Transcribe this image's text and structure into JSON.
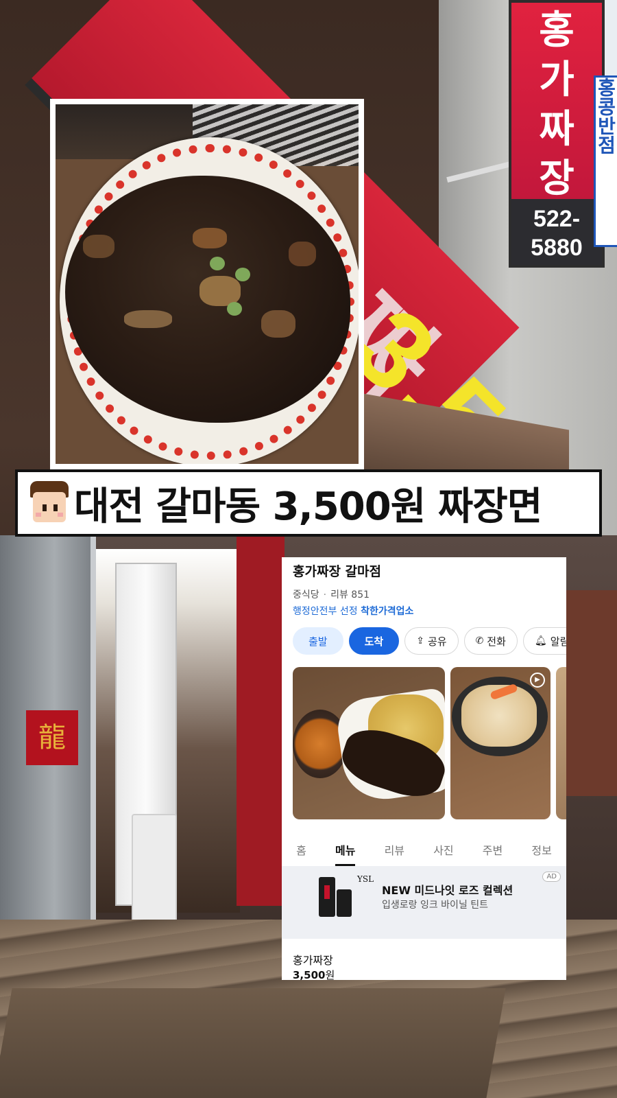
{
  "signage": {
    "main_deco": "가 짜 장",
    "main_price": "3,500",
    "vertical_text": "홍\n가\n짜\n장",
    "phone": "522-5880",
    "blue_sign": "홍콩반점"
  },
  "banner": {
    "title": "대전 갈마동 3,500원 짜장면"
  },
  "card": {
    "name": "홍가짜장 갈마점",
    "category": "중식당",
    "reviews": "리뷰 851",
    "gov_prefix": "행정안전부 선정",
    "gov_highlight": "착한가격업소",
    "buttons": {
      "depart": "출발",
      "arrive": "도착",
      "share": "공유",
      "call": "전화",
      "alert": "알림받기"
    },
    "tabs": [
      "홈",
      "메뉴",
      "리뷰",
      "사진",
      "주변",
      "정보"
    ],
    "active_tab": "메뉴",
    "ad": {
      "brand": "YSL",
      "title": "NEW 미드나잇 로즈 컬렉션",
      "subtitle": "입생로랑 잉크 바이닐 틴트",
      "badge": "AD"
    },
    "menu_item": {
      "name": "홍가짜장",
      "price": "3,500",
      "currency": "원"
    }
  },
  "colors": {
    "accent_blue": "#1a66e0",
    "sign_red": "#d8263b",
    "price_yellow": "#f4e42a"
  },
  "icons": [
    "share-icon",
    "phone-icon",
    "bell-icon",
    "video-play-icon",
    "avatar-icon",
    "dragon-icon"
  ]
}
